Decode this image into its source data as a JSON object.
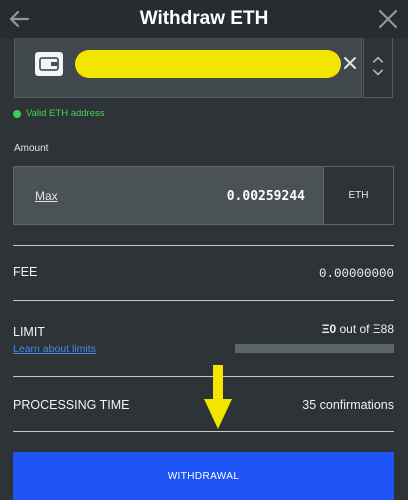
{
  "header": {
    "title": "Withdraw ETH"
  },
  "address": {
    "value": "",
    "validation_message": "Valid ETH address",
    "highlight_color": "#f3e500"
  },
  "amount": {
    "label": "Amount",
    "max_label": "Max",
    "value": "0.00259244",
    "currency": "ETH"
  },
  "fee": {
    "label": "FEE",
    "value": "0.00000000"
  },
  "limit": {
    "label": "LIMIT",
    "used": "Ξ0",
    "separator_text": " out of ",
    "total": "Ξ88",
    "learn_link": "Learn about limits",
    "progress_fraction": 0
  },
  "processing": {
    "label": "PROCESSING TIME",
    "value": "35 confirmations"
  },
  "actions": {
    "withdraw_label": "WITHDRAWAL"
  },
  "colors": {
    "background": "#2d3336",
    "accent_button": "#1e54f5",
    "valid_green": "#35d24f",
    "link_blue": "#3f8ce8",
    "annotation_yellow": "#f3e500"
  },
  "icons": {
    "back": "arrow-left-icon",
    "close": "close-icon",
    "wallet": "wallet-icon",
    "clear": "clear-icon",
    "spinner": "chevron-up-down-icon",
    "annotation": "arrow-down-icon"
  }
}
